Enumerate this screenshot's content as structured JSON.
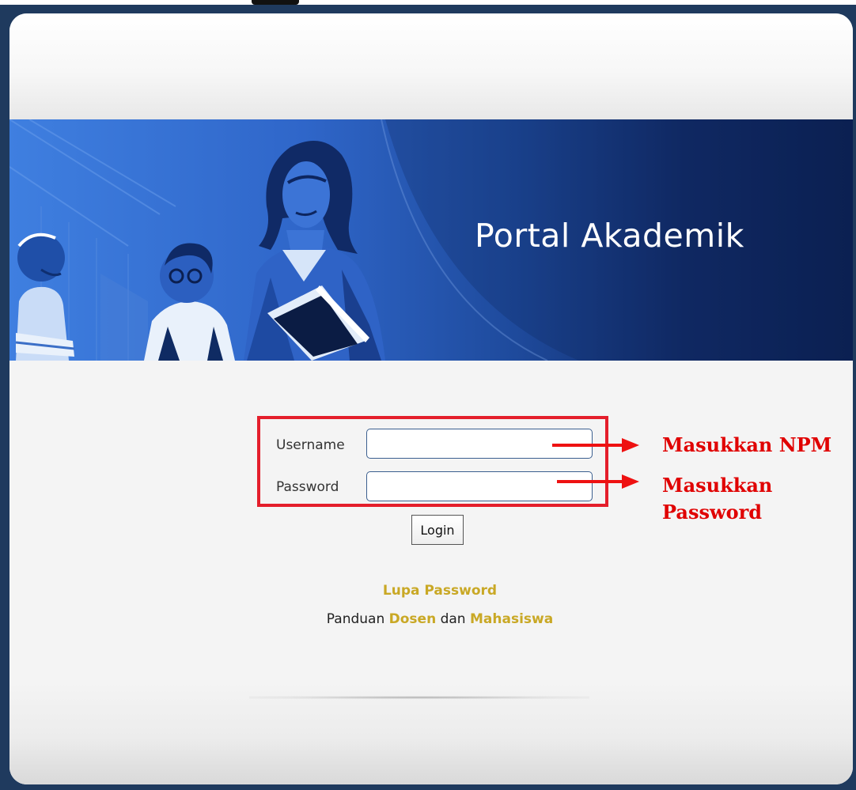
{
  "banner": {
    "title": "Portal Akademik"
  },
  "login_form": {
    "username_label": "Username",
    "username_value": "",
    "password_label": "Password",
    "password_value": "",
    "login_label": "Login"
  },
  "annotations": {
    "npm": "Masukkan NPM",
    "password_line1": "Masukkan",
    "password_line2": "Password"
  },
  "links": {
    "forgot_password": "Lupa Password",
    "guide_prefix": "Panduan",
    "guide_dosen": "Dosen",
    "guide_conjunction": "dan",
    "guide_mahasiswa": "Mahasiswa"
  },
  "colors": {
    "annotation_red": "#e00000",
    "highlight_border": "#e41e2b",
    "link_gold": "#c9a825",
    "banner_blue": "#2f66c9",
    "frame_navy": "#1f3a5e"
  }
}
